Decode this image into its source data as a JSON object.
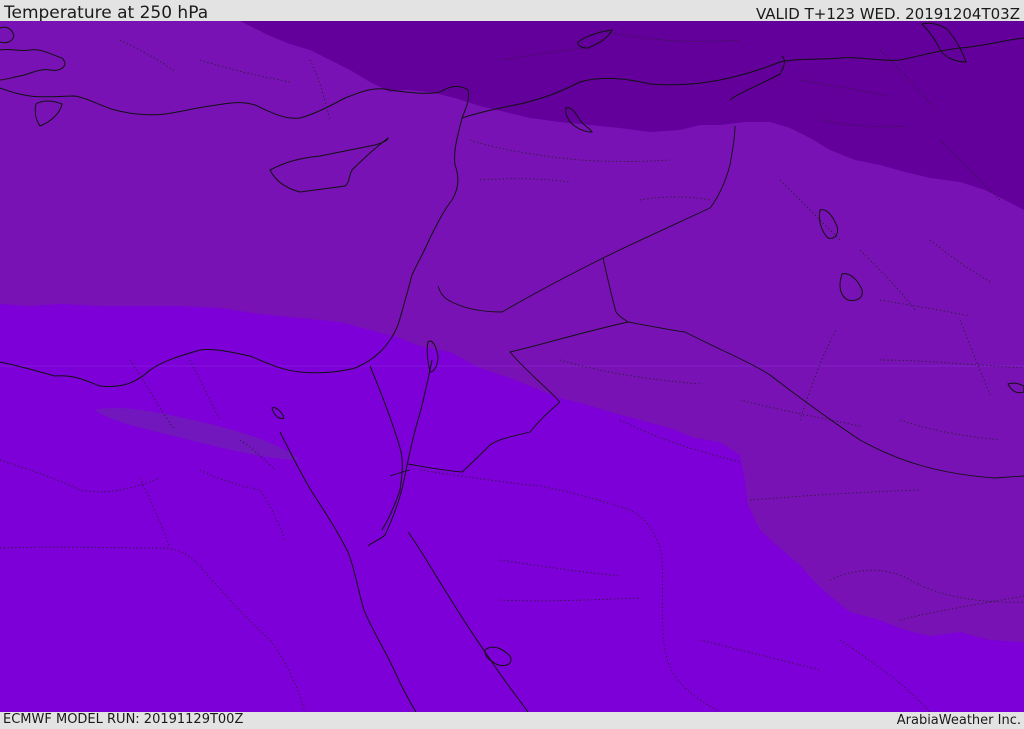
{
  "header": {
    "title": "Temperature at 250 hPa",
    "valid": "VALID T+123 WED. 20191204T03Z"
  },
  "footer": {
    "model_run": "ECMWF MODEL RUN: 20191129T00Z",
    "credit": "ArabiaWeather Inc."
  },
  "colors": {
    "band_coldest": "#63009c",
    "band_middle": "#7812b4",
    "band_warm": "#7e00d8",
    "warm_patch": "#7216bd",
    "bar_background": "#e3e3e3"
  }
}
